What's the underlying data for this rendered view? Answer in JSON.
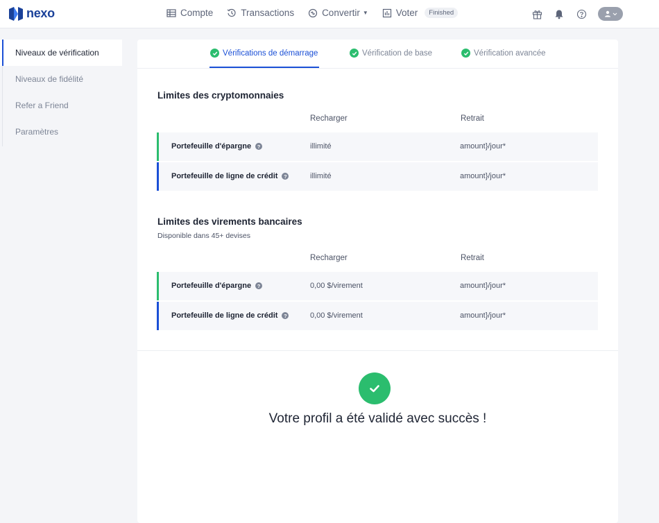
{
  "brand": {
    "name": "nexo"
  },
  "nav": [
    {
      "label": "Compte",
      "icon": "table-icon"
    },
    {
      "label": "Transactions",
      "icon": "history-icon"
    },
    {
      "label": "Convertir",
      "icon": "convert-icon"
    },
    {
      "label": "Voter",
      "icon": "chart-icon",
      "badge": "Finished"
    }
  ],
  "header_icons": [
    "gift-icon",
    "bell-icon",
    "help-icon",
    "user-icon"
  ],
  "sidebar": {
    "items": [
      {
        "label": "Niveaux de vérification",
        "active": true
      },
      {
        "label": "Niveaux de fidélité"
      },
      {
        "label": "Refer a Friend"
      },
      {
        "label": "Paramètres"
      }
    ]
  },
  "tabs": [
    {
      "label": "Vérifications de démarrage",
      "active": true
    },
    {
      "label": "Vérification de base"
    },
    {
      "label": "Vérification avancée"
    }
  ],
  "crypto": {
    "title": "Limites des cryptomonnaies",
    "col_deposit": "Recharger",
    "col_withdraw": "Retrait",
    "rows": [
      {
        "name": "Portefeuille d'épargne",
        "deposit": "illimité",
        "withdraw": "amount}/jour*",
        "accent": "#2bbd6e"
      },
      {
        "name": "Portefeuille de ligne de crédit",
        "deposit": "illimité",
        "withdraw": "amount}/jour*",
        "accent": "#1a4fd6"
      }
    ]
  },
  "bank": {
    "title": "Limites des virements bancaires",
    "subtitle": "Disponible dans 45+ devises",
    "col_deposit": "Recharger",
    "col_withdraw": "Retrait",
    "rows": [
      {
        "name": "Portefeuille d'épargne",
        "deposit": "0,00 $/virement",
        "withdraw": "amount}/jour*",
        "accent": "#2bbd6e"
      },
      {
        "name": "Portefeuille de ligne de crédit",
        "deposit": "0,00 $/virement",
        "withdraw": "amount}/jour*",
        "accent": "#1a4fd6"
      }
    ]
  },
  "success": {
    "message": "Votre profil a été validé avec succès !",
    "icon": "check-circle-icon"
  },
  "colors": {
    "accent_blue": "#1a4fd6",
    "accent_green": "#2bbd6e"
  }
}
